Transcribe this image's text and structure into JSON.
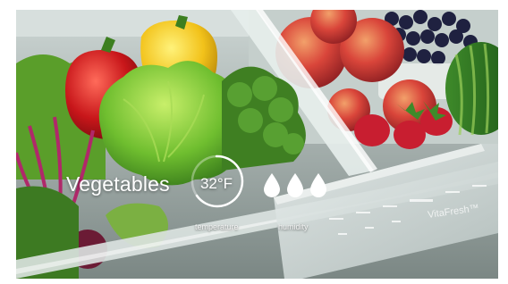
{
  "drawer": {
    "label": "Vegetables",
    "temperature": {
      "value": "32°F",
      "caption": "temperature"
    },
    "humidity": {
      "caption": "humidity",
      "drops": 3
    }
  },
  "panel": {
    "brand": "VitaFresh™"
  },
  "colors": {
    "ui_white": "#ffffff",
    "drawer_tint": "#dfe7e5"
  }
}
